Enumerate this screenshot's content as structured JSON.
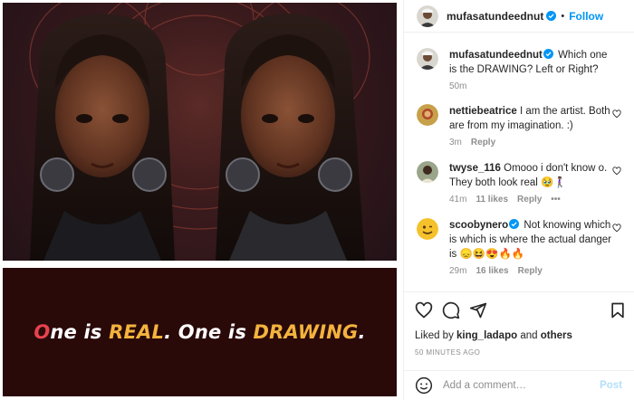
{
  "media": {
    "banner": {
      "o_letter": "O",
      "part1": "ne is ",
      "real": "REAL",
      "part2": ". One is ",
      "drawing": "DRAWING",
      "end": "."
    }
  },
  "post": {
    "author": "mufasatundeednut",
    "separator": "•",
    "follow_label": "Follow",
    "caption": {
      "username": "mufasatundeednut",
      "text": "Which one is the DRAWING? Left or Right?",
      "time": "50m"
    },
    "comments": [
      {
        "username": "nettiebeatrice",
        "verified": false,
        "text": "I am the artist. Both are from my imagination. :)",
        "time": "3m",
        "likes": "",
        "reply": "Reply",
        "more": ""
      },
      {
        "username": "twyse_116",
        "verified": false,
        "text": "Omooo i don't know o. They both look real 🥹🚶🏾‍♀️",
        "time": "41m",
        "likes": "11 likes",
        "reply": "Reply",
        "more": "•••"
      },
      {
        "username": "scoobynero",
        "verified": true,
        "text": "Not knowing which is which is where the actual danger is 😞😆😍🔥🔥",
        "time": "29m",
        "likes": "16 likes",
        "reply": "Reply",
        "more": ""
      }
    ],
    "liked_by": {
      "prefix": "Liked by ",
      "user": "king_ladapo",
      "mid": " and ",
      "others": "others"
    },
    "timestamp": "50 MINUTES AGO",
    "add_comment": {
      "placeholder": "Add a comment…",
      "post_label": "Post"
    }
  },
  "colors": {
    "link_blue": "#0095f6",
    "post_disabled": "#b2dffc",
    "banner_bg": "#2a0909",
    "highlight": "#f3b33d",
    "accent_red": "#e8424e"
  },
  "icons": [
    "verified-badge-icon",
    "heart-icon",
    "comment-icon",
    "share-icon",
    "save-icon",
    "emoji-icon"
  ]
}
